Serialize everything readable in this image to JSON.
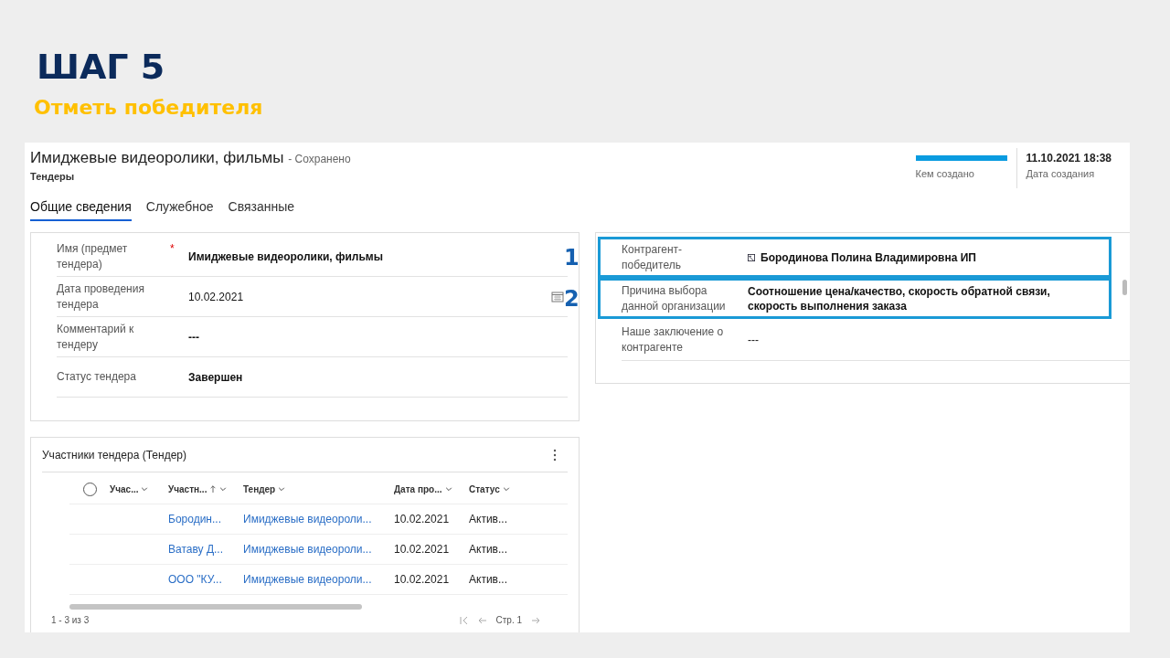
{
  "slide": {
    "step": "ШАГ 5",
    "subtitle": "Отметь победителя"
  },
  "record": {
    "title": "Имиджевые видеоролики, фильмы",
    "save_state": "- Сохранено",
    "entity": "Тендеры",
    "header_fields": [
      {
        "kind": "redacted",
        "label": "Кем создано"
      },
      {
        "kind": "text",
        "value": "11.10.2021 18:38",
        "label": "Дата создания"
      }
    ]
  },
  "tabs": [
    {
      "label": "Общие сведения",
      "selected": true
    },
    {
      "label": "Служебное",
      "selected": false
    },
    {
      "label": "Связанные",
      "selected": false
    }
  ],
  "general_section": {
    "fields": [
      {
        "label": "Имя (предмет тендера)",
        "value": "Имиджевые видеоролики, фильмы",
        "kind": "text",
        "required_mark": "*"
      },
      {
        "label": "Дата проведения тендера",
        "value": "10.02.2021",
        "kind": "date"
      },
      {
        "label": "Комментарий к тендеру",
        "value": "---",
        "kind": "text"
      },
      {
        "label": "Статус тендера",
        "value": "Завершен",
        "kind": "text"
      }
    ]
  },
  "winner_section": {
    "fields": [
      {
        "label": "Контрагент-победитель",
        "value": "Бородинова Полина Владимировна ИП",
        "kind": "lookup",
        "callout": "1"
      },
      {
        "label": "Причина выбора данной организации",
        "value": "Соотношение цена/качество, скорость обратной связи, скорость выполнения заказа",
        "kind": "text",
        "callout": "2"
      },
      {
        "label": "Наше заключение о контрагенте",
        "value": "---",
        "kind": "empty"
      }
    ]
  },
  "participants_grid": {
    "title": "Участники тендера (Тендер)",
    "all_selected": false,
    "columns": [
      {
        "label": "Учас...",
        "sorted": false
      },
      {
        "label": "Участн...",
        "sorted": true
      },
      {
        "label": "Тендер",
        "sorted": false
      },
      {
        "label": "Дата про...",
        "sorted": false
      },
      {
        "label": "Статус",
        "sorted": false
      }
    ],
    "rows": [
      {
        "cells": [
          "",
          "Бородин...",
          "Имиджевые видеороли...",
          "10.02.2021",
          "Актив..."
        ]
      },
      {
        "cells": [
          "",
          "Ватаву Д...",
          "Имиджевые видеороли...",
          "10.02.2021",
          "Актив..."
        ]
      },
      {
        "cells": [
          "",
          "ООО \"КУ...",
          "Имиджевые видеороли...",
          "10.02.2021",
          "Актив..."
        ]
      }
    ],
    "record_count": "1 - 3 из 3",
    "page": "Стр. 1"
  }
}
